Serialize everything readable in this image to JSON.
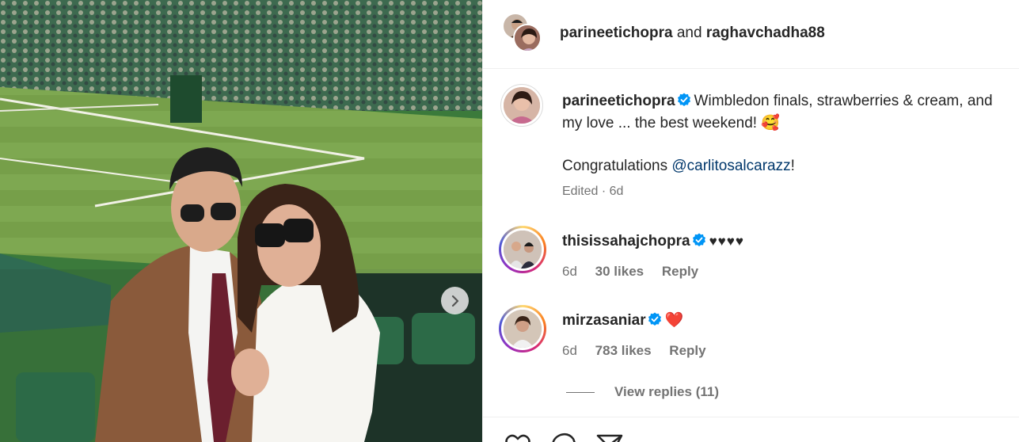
{
  "post": {
    "slide_next_icon": "chevron-right-icon"
  },
  "header": {
    "user1": "parineetichopra",
    "and_label": "and",
    "user2": "raghavchadha88"
  },
  "caption": {
    "username": "parineetichopra",
    "text_line1": "Wimbledon finals, strawberries & cream, and",
    "text_line2": "my love ... the best weekend!",
    "emoji": "🥰",
    "congrats_prefix": "Congratulations ",
    "mention": "@carlitosalcarazz",
    "congrats_suffix": "!",
    "edited": "Edited",
    "separator": " · ",
    "time": "6d"
  },
  "comments": [
    {
      "username": "thisissahajchopra",
      "text": "♥♥♥♥",
      "time": "6d",
      "likes": "30 likes",
      "reply": "Reply"
    },
    {
      "username": "mirzasaniar",
      "text": "❤️",
      "time": "6d",
      "likes": "783 likes",
      "reply": "Reply"
    }
  ],
  "view_replies": "View replies (11)",
  "colors": {
    "verified": "#0095f6",
    "mention": "#00376b",
    "secondary_text": "#737373",
    "heart_red": "#ed1c24"
  }
}
